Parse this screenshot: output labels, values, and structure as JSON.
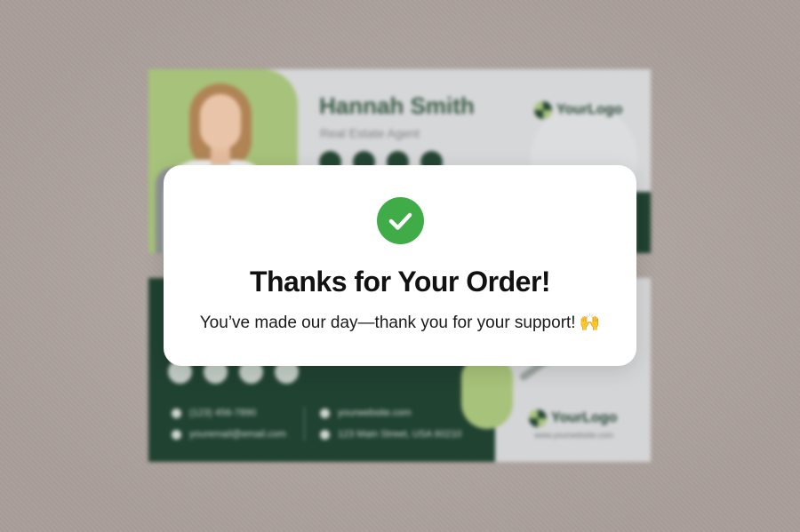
{
  "background_preview": {
    "card1": {
      "name": "Hannah Smith",
      "role": "Real Estate Agent",
      "logo_text": "YourLogo"
    },
    "card2": {
      "phone": "(123) 456-7890",
      "email": "youremail@email.com",
      "website": "yourwebsite.com",
      "address": "123 Main Street, USA 60210",
      "logo_text": "YourLogo",
      "logo_subtext": "www.yourwebsite.com"
    }
  },
  "modal": {
    "icon": "check-icon",
    "title": "Thanks for Your Order!",
    "message": "You’ve made our day—thank you for your support!",
    "emoji": "🙌"
  },
  "colors": {
    "success_green": "#3fac47",
    "brand_dark_green": "#204231",
    "brand_light_green": "#a7c27a",
    "backdrop": "#b2a7a2"
  }
}
